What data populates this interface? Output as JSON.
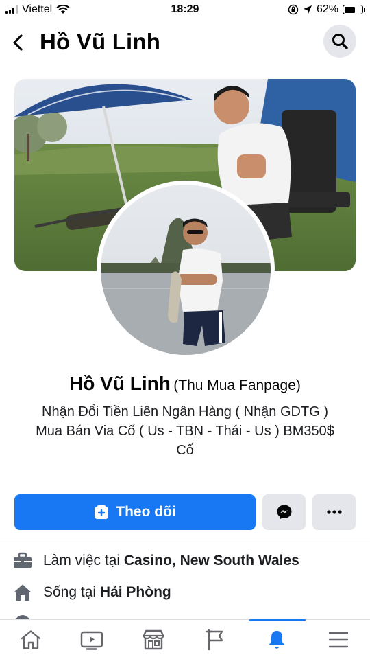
{
  "status_bar": {
    "carrier": "Viettel",
    "time": "18:29",
    "battery": "62%",
    "battery_level": 0.62
  },
  "header": {
    "title": "Hồ Vũ Linh"
  },
  "profile": {
    "name": "Hồ Vũ Linh",
    "alternate_name": "(Thu Mua Fanpage)",
    "bio_lines": [
      "Nhận Đổi Tiền Liên Ngân Hàng ( Nhận GDTG )",
      "Mua Bán Via Cổ ( Us - TBN - Thái - Us ) BM350$",
      "Cổ"
    ]
  },
  "actions": {
    "follow_label": "Theo dõi",
    "messenger_icon": "messenger-icon",
    "more_icon": "more-icon"
  },
  "info": [
    {
      "icon": "briefcase-icon",
      "prefix": "Làm việc tại ",
      "value": "Casino, New South Wales"
    },
    {
      "icon": "home-icon",
      "prefix": "Sống tại ",
      "value": "Hải Phòng"
    }
  ],
  "bottom_nav": [
    {
      "name": "home",
      "icon": "home-icon",
      "active": false
    },
    {
      "name": "watch",
      "icon": "video-icon",
      "active": false
    },
    {
      "name": "marketplace",
      "icon": "store-icon",
      "active": false
    },
    {
      "name": "pages",
      "icon": "flag-icon",
      "active": false
    },
    {
      "name": "notifications",
      "icon": "bell-icon",
      "active": true
    },
    {
      "name": "menu",
      "icon": "menu-icon",
      "active": false
    }
  ],
  "colors": {
    "accent": "#1877f2",
    "button_gray": "#e4e6eb",
    "text": "#050505"
  }
}
